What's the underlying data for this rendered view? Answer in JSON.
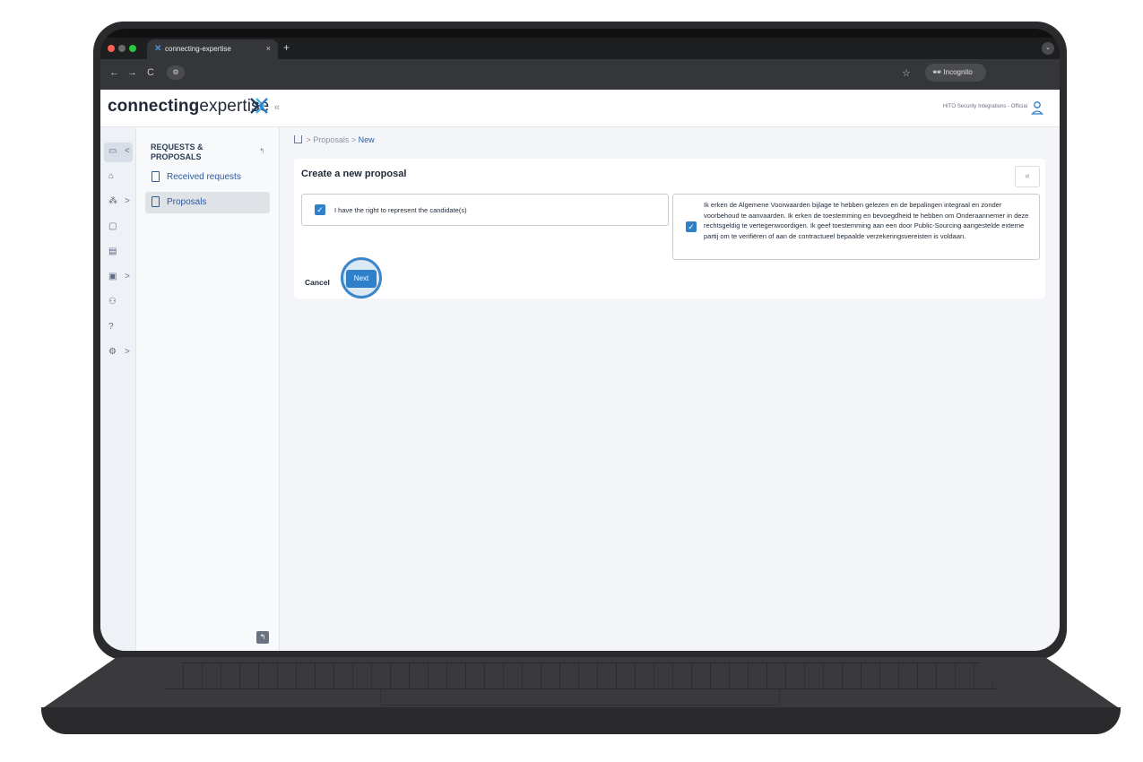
{
  "browser": {
    "tab_title": "connecting-expertise",
    "tab_close": "×",
    "new_tab": "+",
    "back": "←",
    "forward": "→",
    "reload": "C",
    "star": "☆",
    "incognito_label": "Incognito"
  },
  "header": {
    "logo_bold": "connecting",
    "logo_light": "expertise",
    "collapse": "«",
    "org_name": "HITO Security Integrations - Official"
  },
  "rail": {
    "arrows": [
      ">",
      ">",
      ">",
      ">"
    ],
    "collapse_arrow": "<"
  },
  "submenu": {
    "title": "REQUESTS & PROPOSALS",
    "items": [
      {
        "label": "Received requests"
      },
      {
        "label": "Proposals"
      }
    ]
  },
  "breadcrumb": {
    "sep": ">",
    "parent": "Proposals",
    "current": "New"
  },
  "card": {
    "title": "Create a new proposal",
    "collapse": "«",
    "checkbox_a_label": "I have the right to represent the candidate(s)",
    "checkbox_b_label": "Ik erken de Algemene Voorwaarden bijlage te hebben gelezen en de bepalingen integraal en zonder voorbehoud te aanvaarden. Ik erken de toestemming en bevoegdheid te hebben om Onderaannemer in deze rechtsgeldig te vertegenwoordigen. Ik geef toestemming aan een door Public-Sourcing aangestelde externe partij om te verifiëren of aan de contractueel bepaalde verzekeringsvereisten is voldaan.",
    "cancel_label": "Cancel",
    "next_label": "Next"
  },
  "colors": {
    "accent": "#2f80c8",
    "link": "#2d5aa0"
  }
}
